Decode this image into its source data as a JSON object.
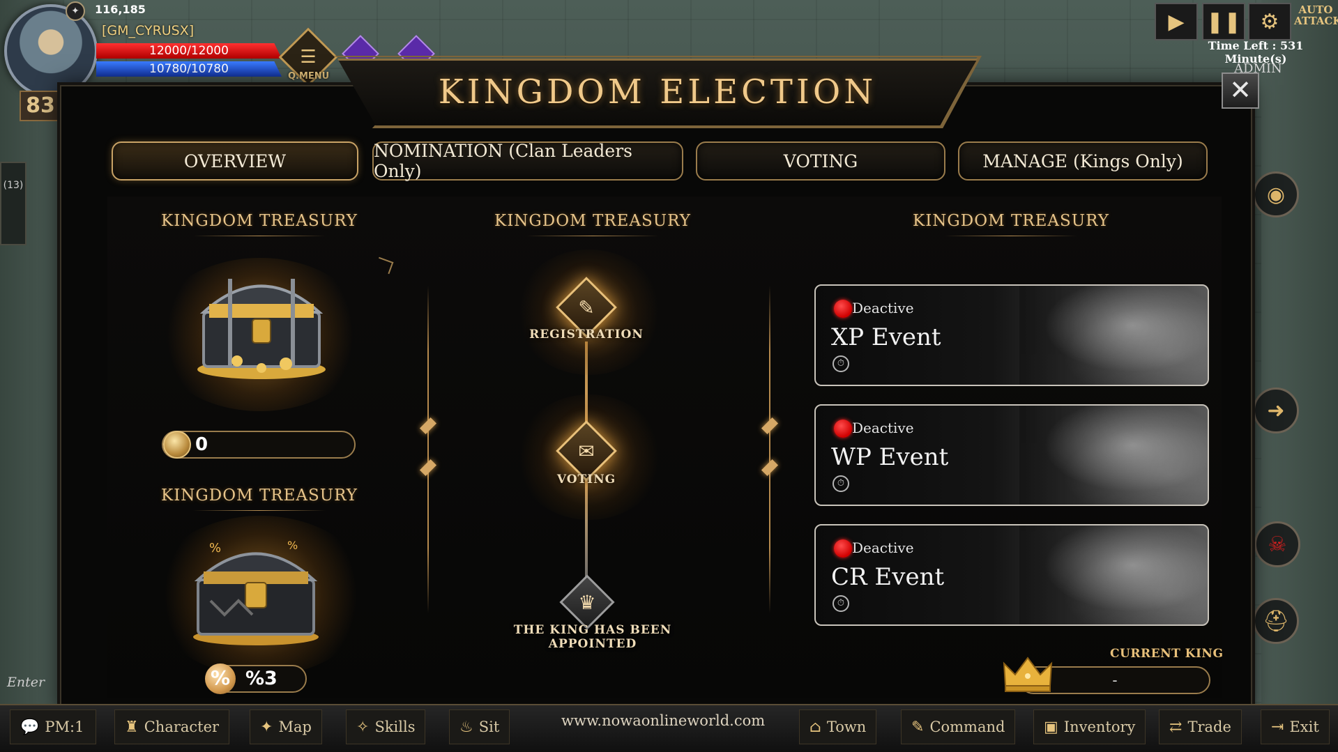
{
  "hud": {
    "gold": "116,185",
    "player_name": "[GM_CYRUSX]",
    "hp": "12000/12000",
    "mp": "10780/10780",
    "level": "83",
    "quick_menu_label": "Q.MENU",
    "auto_attack_label": "AUTO ATTACK",
    "time_left": "Time Left : 531 Minute(s)",
    "admin_label": "ADMIN",
    "scroll_count": "(13)",
    "chat_placeholder": "Enter te"
  },
  "panel": {
    "title": "KINGDOM  ELECTION",
    "tabs": [
      {
        "label": "OVERVIEW",
        "active": true
      },
      {
        "label": "NOMINATION (Clan Leaders Only)",
        "active": false
      },
      {
        "label": "VOTING",
        "active": false
      },
      {
        "label": "MANAGE (Kings Only)",
        "active": false
      }
    ],
    "left": {
      "treasury_title": "KINGDOM TREASURY",
      "treasury_value": "0",
      "tax_title": "KINGDOM TREASURY",
      "tax_value": "%3"
    },
    "middle": {
      "title": "KINGDOM TREASURY",
      "steps": [
        {
          "label": "REGISTRATION",
          "state": "active"
        },
        {
          "label": "VOTING",
          "state": "active"
        },
        {
          "label": "THE KING HAS BEEN APPOINTED",
          "state": "done"
        }
      ]
    },
    "right": {
      "title": "KINGDOM TREASURY",
      "events": [
        {
          "status": "Deactive",
          "name": "XP Event"
        },
        {
          "status": "Deactive",
          "name": "WP Event"
        },
        {
          "status": "Deactive",
          "name": "CR Event"
        }
      ],
      "current_king_label": "CURRENT KING",
      "current_king_value": "-"
    }
  },
  "bottom_bar": {
    "items": [
      "PM:1",
      "Character",
      "Map",
      "Skills",
      "Sit",
      "Town",
      "Command",
      "Inventory",
      "Trade",
      "Exit"
    ],
    "url": "www.nowaonlineworld.com"
  },
  "colors": {
    "accent_gold": "#e7c48a",
    "hp_red": "#d00000",
    "mp_blue": "#1436a8",
    "deactive_red": "#ff2020"
  }
}
